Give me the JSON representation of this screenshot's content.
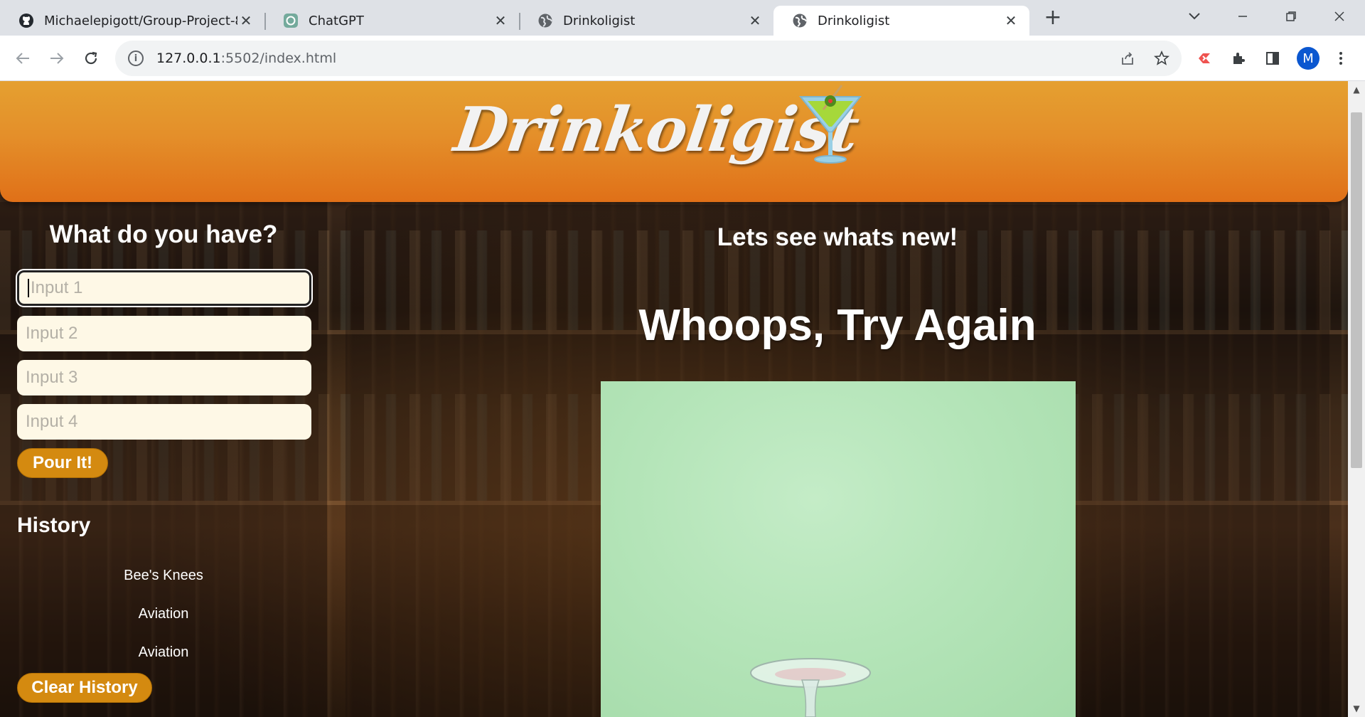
{
  "browser": {
    "tabs": [
      {
        "title": "Michaelepigott/Group-Project-8",
        "icon": "github-icon"
      },
      {
        "title": "ChatGPT",
        "icon": "chatgpt-icon"
      },
      {
        "title": "Drinkoligist",
        "icon": "globe-icon"
      },
      {
        "title": "Drinkoligist",
        "icon": "globe-icon",
        "active": true
      }
    ],
    "url_host": "127.0.0.1",
    "url_rest": ":5502/index.html",
    "profile_initial": "M"
  },
  "header": {
    "logo_text": "Drinkoligist"
  },
  "left": {
    "title": "What do you have?",
    "inputs": [
      {
        "placeholder": "Input 1"
      },
      {
        "placeholder": "Input 2"
      },
      {
        "placeholder": "Input 3"
      },
      {
        "placeholder": "Input 4"
      }
    ],
    "pour_label": "Pour It!",
    "history_title": "History",
    "history": [
      "Bee's Knees",
      "Aviation",
      "Aviation"
    ],
    "clear_label": "Clear History"
  },
  "right": {
    "title": "Lets see whats new!",
    "message": "Whoops, Try Again"
  }
}
